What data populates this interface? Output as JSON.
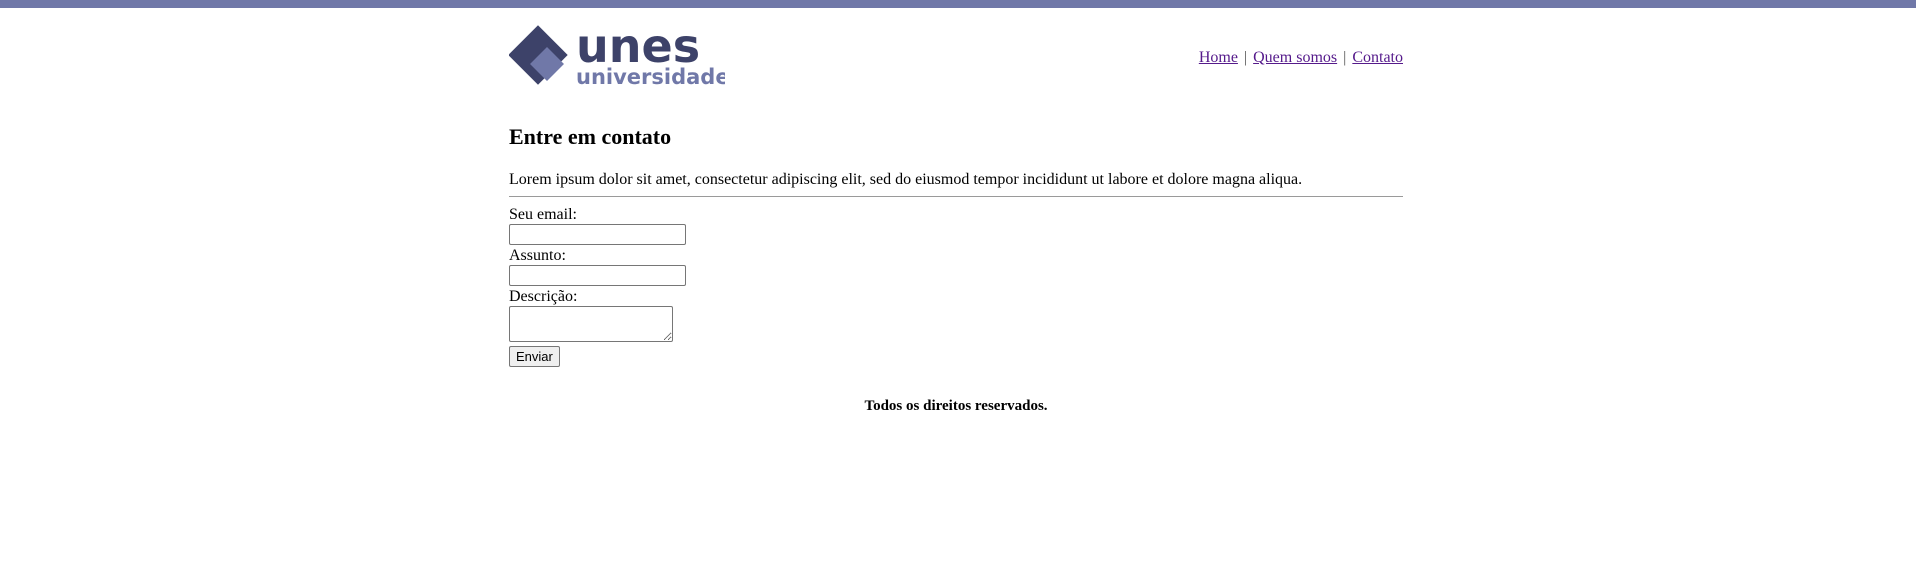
{
  "colors": {
    "top_bar": "#7078a8",
    "logo_dark": "#3d4269",
    "logo_light": "#7078a8",
    "link": "#551a8b"
  },
  "logo": {
    "name": "unes",
    "subtitle": "universidade"
  },
  "nav": {
    "items": [
      {
        "label": "Home"
      },
      {
        "label": "Quem somos"
      },
      {
        "label": "Contato"
      }
    ],
    "separator": "|"
  },
  "main": {
    "title": "Entre em contato",
    "intro": "Lorem ipsum dolor sit amet, consectetur adipiscing elit, sed do eiusmod tempor incididunt ut labore et dolore magna aliqua."
  },
  "form": {
    "email_label": "Seu email:",
    "email_value": "",
    "subject_label": "Assunto:",
    "subject_value": "",
    "description_label": "Descrição:",
    "description_value": "",
    "submit_label": "Enviar"
  },
  "footer": {
    "text": "Todos os direitos reservados."
  }
}
